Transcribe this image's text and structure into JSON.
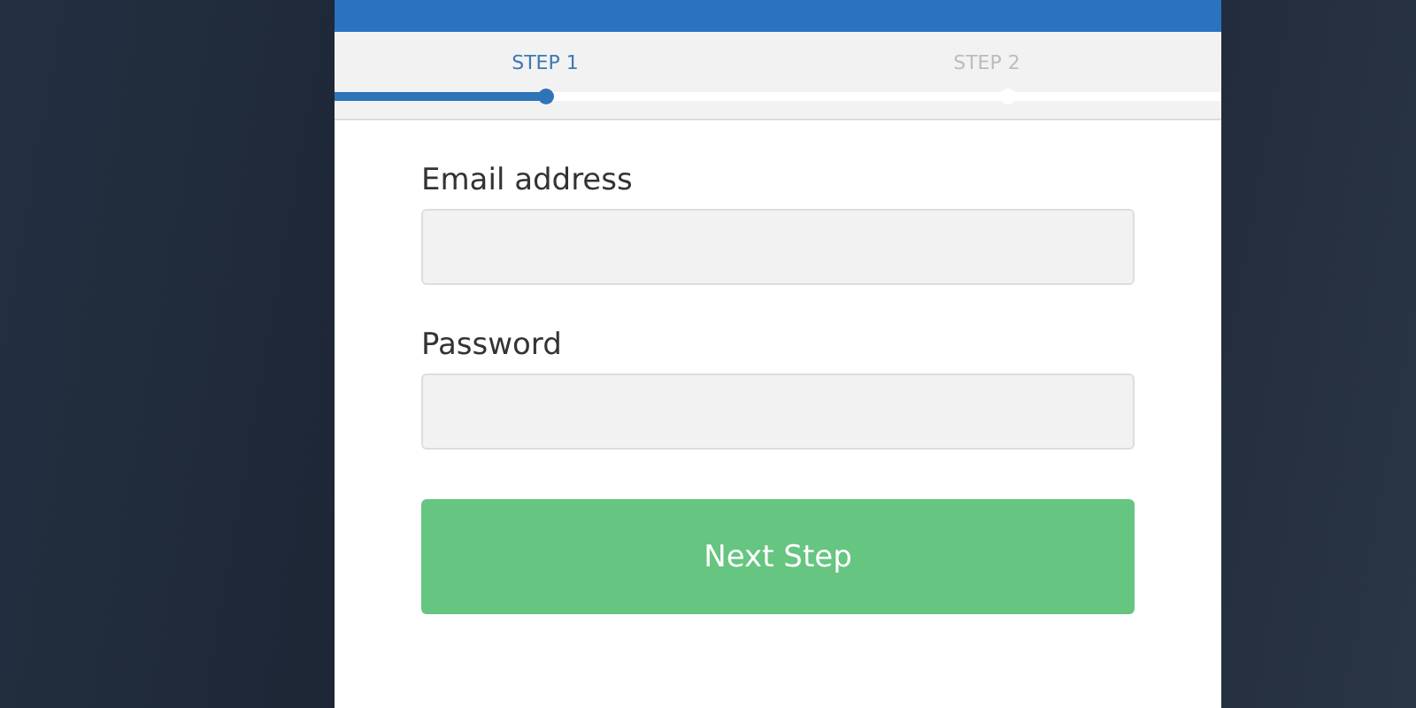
{
  "steps": [
    {
      "label": "STEP 1",
      "selected": true
    },
    {
      "label": "STEP 2",
      "selected": false
    }
  ],
  "progress": {
    "level": 0.24
  },
  "form": {
    "fields": [
      {
        "label": "Email address"
      },
      {
        "label": "Password"
      }
    ],
    "submit": "Next Step"
  }
}
